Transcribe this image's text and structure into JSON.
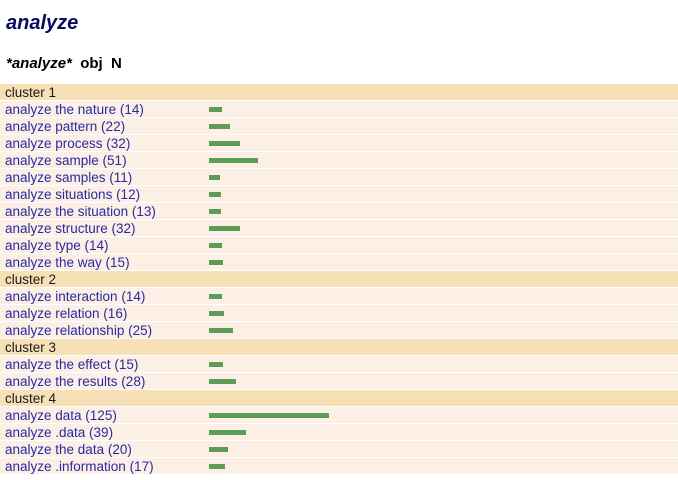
{
  "page": {
    "title": "analyze",
    "subtitle_kw": "*analyze*",
    "subtitle_rest": "  obj  N"
  },
  "scale_max": 125,
  "clusters": [
    {
      "label": "cluster 1",
      "items": [
        {
          "text": "analyze the nature (14)",
          "count": 14
        },
        {
          "text": "analyze pattern (22)",
          "count": 22
        },
        {
          "text": "analyze process (32)",
          "count": 32
        },
        {
          "text": "analyze sample (51)",
          "count": 51
        },
        {
          "text": "analyze samples (11)",
          "count": 11
        },
        {
          "text": "analyze situations (12)",
          "count": 12
        },
        {
          "text": "analyze the situation (13)",
          "count": 13
        },
        {
          "text": "analyze structure (32)",
          "count": 32
        },
        {
          "text": "analyze type (14)",
          "count": 14
        },
        {
          "text": "analyze the way (15)",
          "count": 15
        }
      ]
    },
    {
      "label": "cluster 2",
      "items": [
        {
          "text": "analyze interaction (14)",
          "count": 14
        },
        {
          "text": "analyze relation (16)",
          "count": 16
        },
        {
          "text": "analyze relationship (25)",
          "count": 25
        }
      ]
    },
    {
      "label": "cluster 3",
      "items": [
        {
          "text": "analyze the effect (15)",
          "count": 15
        },
        {
          "text": "analyze the results (28)",
          "count": 28
        }
      ]
    },
    {
      "label": "cluster 4",
      "items": [
        {
          "text": "analyze data (125)",
          "count": 125
        },
        {
          "text": "analyze .data (39)",
          "count": 39
        },
        {
          "text": "analyze the data (20)",
          "count": 20
        },
        {
          "text": "analyze .information (17)",
          "count": 17
        }
      ]
    }
  ],
  "colors": {
    "bar": "#5d9c57",
    "cluster_bg": "#f7e0b6",
    "row_bg": "#fcefe6",
    "link": "#2a2aa0",
    "title": "#0b0b5e"
  }
}
